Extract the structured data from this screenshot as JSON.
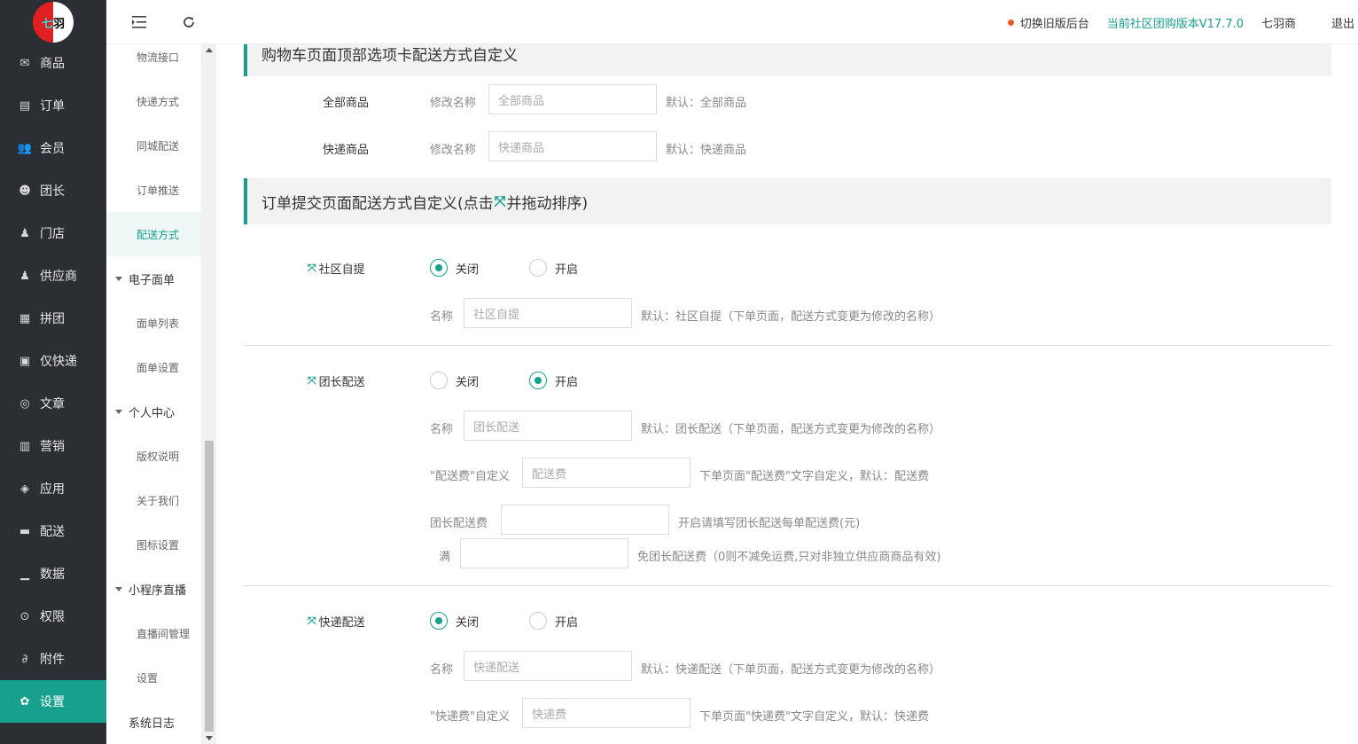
{
  "logo": {
    "text": "七羽"
  },
  "sidebar": {
    "items": [
      {
        "label": "商品",
        "icon": "envelope-icon"
      },
      {
        "label": "订单",
        "icon": "document-icon"
      },
      {
        "label": "会员",
        "icon": "users-icon"
      },
      {
        "label": "团长",
        "icon": "face-icon"
      },
      {
        "label": "门店",
        "icon": "store-user-icon"
      },
      {
        "label": "供应商",
        "icon": "supplier-icon"
      },
      {
        "label": "拼团",
        "icon": "group-buy-icon"
      },
      {
        "label": "仅快递",
        "icon": "truck-box-icon"
      },
      {
        "label": "文章",
        "icon": "compass-icon"
      },
      {
        "label": "营销",
        "icon": "gift-icon"
      },
      {
        "label": "应用",
        "icon": "cube-icon"
      },
      {
        "label": "配送",
        "icon": "delivery-truck-icon"
      },
      {
        "label": "数据",
        "icon": "chart-icon"
      },
      {
        "label": "权限",
        "icon": "lock-icon"
      },
      {
        "label": "附件",
        "icon": "paperclip-icon"
      },
      {
        "label": "设置",
        "icon": "gear-icon"
      }
    ]
  },
  "submenu": {
    "items": [
      {
        "label": "物流接口",
        "type": "item"
      },
      {
        "label": "快递方式",
        "type": "item"
      },
      {
        "label": "同城配送",
        "type": "item"
      },
      {
        "label": "订单推送",
        "type": "item"
      },
      {
        "label": "配送方式",
        "type": "item",
        "active": true
      },
      {
        "label": "电子面单",
        "type": "group"
      },
      {
        "label": "面单列表",
        "type": "item"
      },
      {
        "label": "面单设置",
        "type": "item"
      },
      {
        "label": "个人中心",
        "type": "group"
      },
      {
        "label": "版权说明",
        "type": "item"
      },
      {
        "label": "关于我们",
        "type": "item"
      },
      {
        "label": "图标设置",
        "type": "item"
      },
      {
        "label": "小程序直播",
        "type": "group"
      },
      {
        "label": "直播间管理",
        "type": "item"
      },
      {
        "label": "设置",
        "type": "item"
      },
      {
        "label": "系统日志",
        "type": "group-plain"
      }
    ]
  },
  "header": {
    "switch_old": "切换旧版后台",
    "version": "当前社区团购版本V17.7.0",
    "shop_name": "七羽商",
    "logout": "退出"
  },
  "cart_section": {
    "title": "购物车页面顶部选项卡配送方式自定义",
    "rows": [
      {
        "label": "全部商品",
        "rename": "修改名称",
        "placeholder": "全部商品",
        "default": "默认：全部商品"
      },
      {
        "label": "快递商品",
        "rename": "修改名称",
        "placeholder": "快递商品",
        "default": "默认：快递商品"
      }
    ]
  },
  "order_section": {
    "title_prefix": "订单提交页面配送方式自定义(点击",
    "title_suffix": "并拖动排序)",
    "close_label": "关闭",
    "open_label": "开启",
    "name_label": "名称",
    "community": {
      "label": "社区自提",
      "state": "close",
      "placeholder": "社区自提",
      "default": "默认：社区自提（下单页面，配送方式变更为修改的名称）"
    },
    "leader": {
      "label": "团长配送",
      "state": "open",
      "placeholder": "团长配送",
      "default": "默认：团长配送（下单页面，配送方式变更为修改的名称）",
      "fee_custom_label": "\"配送费\"自定义",
      "fee_custom_placeholder": "配送费",
      "fee_custom_hint": "下单页面\"配送费\"文字自定义，默认：配送费",
      "fee_label": "团长配送费",
      "fee_value": "",
      "fee_hint": "开启请填写团长配送每单配送费(元)",
      "full_label": "满",
      "full_value": "",
      "full_hint": "免团长配送费（0则不减免运费,只对非独立供应商商品有效)"
    },
    "express": {
      "label": "快递配送",
      "state": "close",
      "placeholder": "快递配送",
      "default": "默认：快递配送（下单页面，配送方式变更为修改的名称）",
      "fee_custom_label": "\"快递费\"自定义",
      "fee_custom_placeholder": "快递费",
      "fee_custom_hint": "下单页面\"快递费\"文字自定义，默认：快递费"
    }
  },
  "colors": {
    "accent": "#17a08c",
    "sidebar_bg": "#2b2f33",
    "dot": "#ef5a22"
  }
}
